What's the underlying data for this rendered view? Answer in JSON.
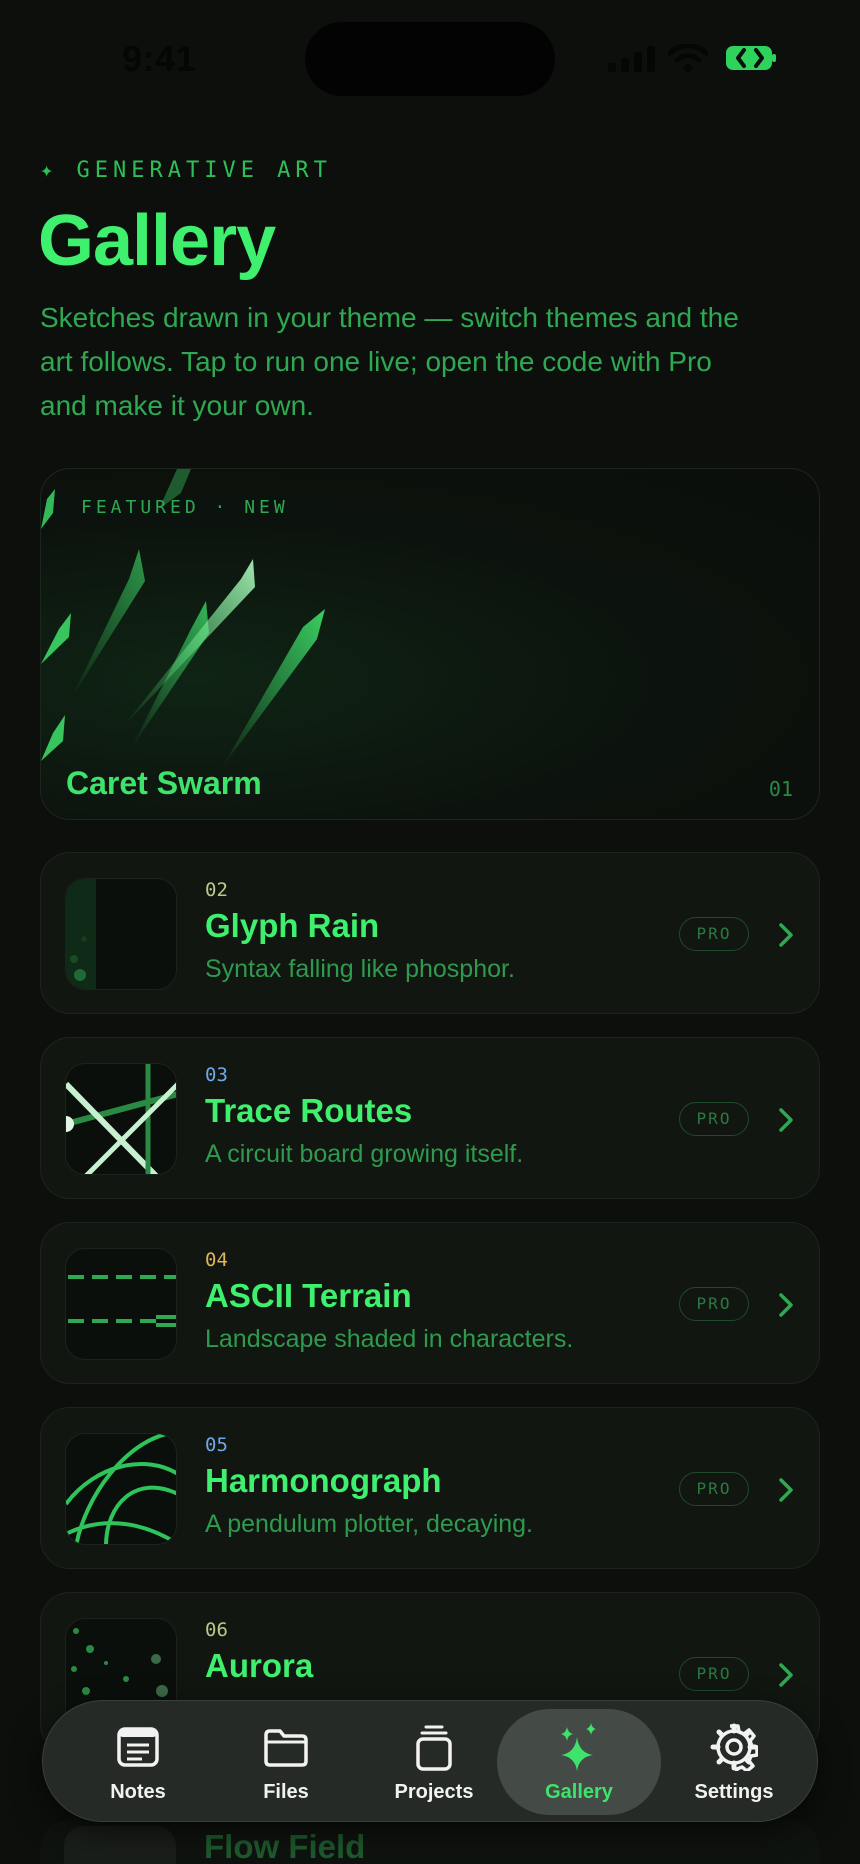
{
  "status_bar": {
    "time": "9:41"
  },
  "header": {
    "eyebrow": "✦ GENERATIVE ART",
    "title": "Gallery",
    "description": "Sketches drawn in your theme — switch themes and the art follows. Tap to run one live; open the code with Pro and make it your own."
  },
  "featured": {
    "tag": "FEATURED · NEW",
    "title": "Caret Swarm",
    "index": "01"
  },
  "sketches": [
    {
      "num": "02",
      "num_color": "#b9c98a",
      "title": "Glyph Rain",
      "subtitle": "Syntax falling like phosphor.",
      "badge": "PRO",
      "thumb_icon": "glyph-rain-thumbnail"
    },
    {
      "num": "03",
      "num_color": "#6fa8e8",
      "title": "Trace Routes",
      "subtitle": "A circuit board growing itself.",
      "badge": "PRO",
      "thumb_icon": "trace-routes-thumbnail"
    },
    {
      "num": "04",
      "num_color": "#e0b45a",
      "title": "ASCII Terrain",
      "subtitle": "Landscape shaded in characters.",
      "badge": "PRO",
      "thumb_icon": "ascii-terrain-thumbnail"
    },
    {
      "num": "05",
      "num_color": "#6fa8e8",
      "title": "Harmonograph",
      "subtitle": "A pendulum plotter, decaying.",
      "badge": "PRO",
      "thumb_icon": "harmonograph-thumbnail"
    },
    {
      "num": "06",
      "num_color": "#b9c98a",
      "title": "Aurora",
      "subtitle": "",
      "badge": "PRO",
      "thumb_icon": "aurora-thumbnail"
    }
  ],
  "peek": {
    "title": "Flow Field"
  },
  "tabs": [
    {
      "label": "Notes",
      "icon": "notes-icon"
    },
    {
      "label": "Files",
      "icon": "folder-icon"
    },
    {
      "label": "Projects",
      "icon": "projects-icon"
    },
    {
      "label": "Gallery",
      "icon": "sparkles-icon",
      "active": true
    },
    {
      "label": "Settings",
      "icon": "gear-icon"
    }
  ],
  "colors": {
    "accent": "#3fe36b",
    "background": "#0d0f0d",
    "card": "#111611"
  }
}
